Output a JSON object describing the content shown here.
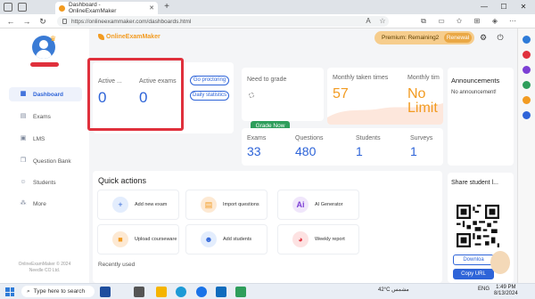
{
  "browser": {
    "tab_title": "Dashboard - OnlineExamMaker",
    "tab_close": "✕",
    "new_tab": "+",
    "url": "https://onlineexammaker.com/dashboards.html",
    "minimize": "—",
    "maximize": "☐",
    "close": "✕"
  },
  "app": {
    "logo": "OnlineExamMaker",
    "premium_text": "Premium:  Remaining2",
    "renewal_label": "Renewal"
  },
  "sidebar": {
    "items": [
      {
        "label": "Dashboard",
        "icon": "dashboard-icon"
      },
      {
        "label": "Exams",
        "icon": "exams-icon"
      },
      {
        "label": "LMS",
        "icon": "lms-icon"
      },
      {
        "label": "Question Bank",
        "icon": "question-bank-icon"
      },
      {
        "label": "Students",
        "icon": "students-icon"
      },
      {
        "label": "More",
        "icon": "more-icon"
      }
    ],
    "copyright_line1": "OnlineExamMaker © 2024",
    "copyright_line2": "Needle CO Ltd."
  },
  "active_stats": {
    "active_1_label": "Active ...",
    "active_1_value": "0",
    "active_exams_label": "Active exams",
    "active_exams_value": "0",
    "go_proctoring": "Go proctoring",
    "daily_statistics": "Daily statistics"
  },
  "grading": {
    "label": "Need to grade",
    "button": "Grade Now"
  },
  "monthly": {
    "taken_label": "Monthly taken times",
    "taken_value": "57",
    "other_label": "Monthly tim",
    "other_value_1": "No",
    "other_value_2": "Limit"
  },
  "counts": [
    {
      "label": "Exams",
      "value": "33"
    },
    {
      "label": "Questions",
      "value": "480"
    },
    {
      "label": "Students",
      "value": "1"
    },
    {
      "label": "Surveys",
      "value": "1"
    }
  ],
  "announcements": {
    "title": "Announcements",
    "empty": "No announcement!"
  },
  "quick_actions": {
    "title": "Quick actions",
    "items": [
      {
        "label": "Add new exam",
        "icon": "plus-icon"
      },
      {
        "label": "Import questions",
        "icon": "import-icon"
      },
      {
        "label": "AI Generator",
        "icon": "ai-icon"
      },
      {
        "label": "Upload courseware",
        "icon": "folder-icon"
      },
      {
        "label": "Add students",
        "icon": "add-student-icon"
      },
      {
        "label": "Weekly report",
        "icon": "pie-chart-icon"
      }
    ]
  },
  "recently_used": {
    "title": "Recently used"
  },
  "share": {
    "title": "Share student l...",
    "download": "Downloa",
    "copy_url": "Copy URL"
  },
  "taskbar": {
    "search_placeholder": "Type here to search",
    "weather": "42°C مشمس",
    "lang": "ENG",
    "time": "1:49 PM",
    "date": "8/13/2024"
  },
  "colors": {
    "accent": "#2e64d8",
    "orange": "#f29b21",
    "highlight": "#e0303c",
    "green": "#2e9e5b"
  }
}
